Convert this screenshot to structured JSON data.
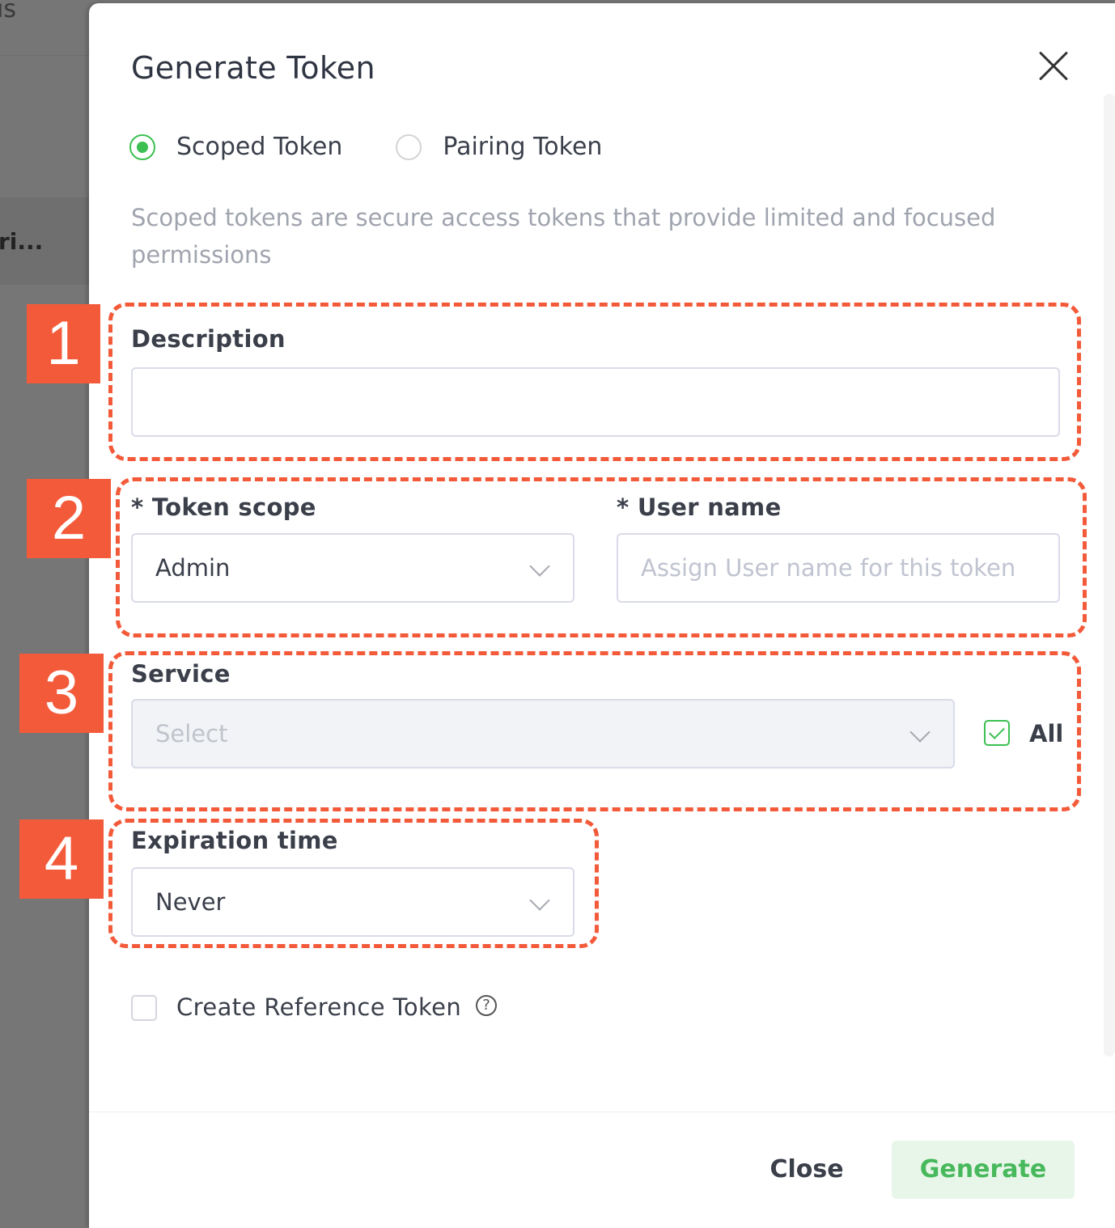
{
  "background": {
    "fragment_top": "ıs",
    "fragment_row": "ri..."
  },
  "modal": {
    "title": "Generate Token",
    "token_types": [
      {
        "label": "Scoped Token",
        "selected": true
      },
      {
        "label": "Pairing Token",
        "selected": false
      }
    ],
    "description_text": "Scoped tokens are secure access tokens that provide limited and focused permissions",
    "fields": {
      "description": {
        "label": "Description",
        "value": ""
      },
      "token_scope": {
        "label": "* Token scope",
        "value": "Admin"
      },
      "user_name": {
        "label": "* User name",
        "placeholder": "Assign User name for this token",
        "value": ""
      },
      "service": {
        "label": "Service",
        "placeholder": "Select",
        "all_label": "All",
        "all_checked": true
      },
      "expiration": {
        "label": "Expiration time",
        "value": "Never"
      },
      "reference_token": {
        "label": "Create Reference Token",
        "checked": false
      }
    },
    "buttons": {
      "close": "Close",
      "generate": "Generate"
    }
  },
  "annotations": [
    "1",
    "2",
    "3",
    "4"
  ],
  "colors": {
    "accent_green": "#3cc052",
    "annotation_orange": "#f35a3a",
    "generate_bg": "#e8f6ea"
  }
}
